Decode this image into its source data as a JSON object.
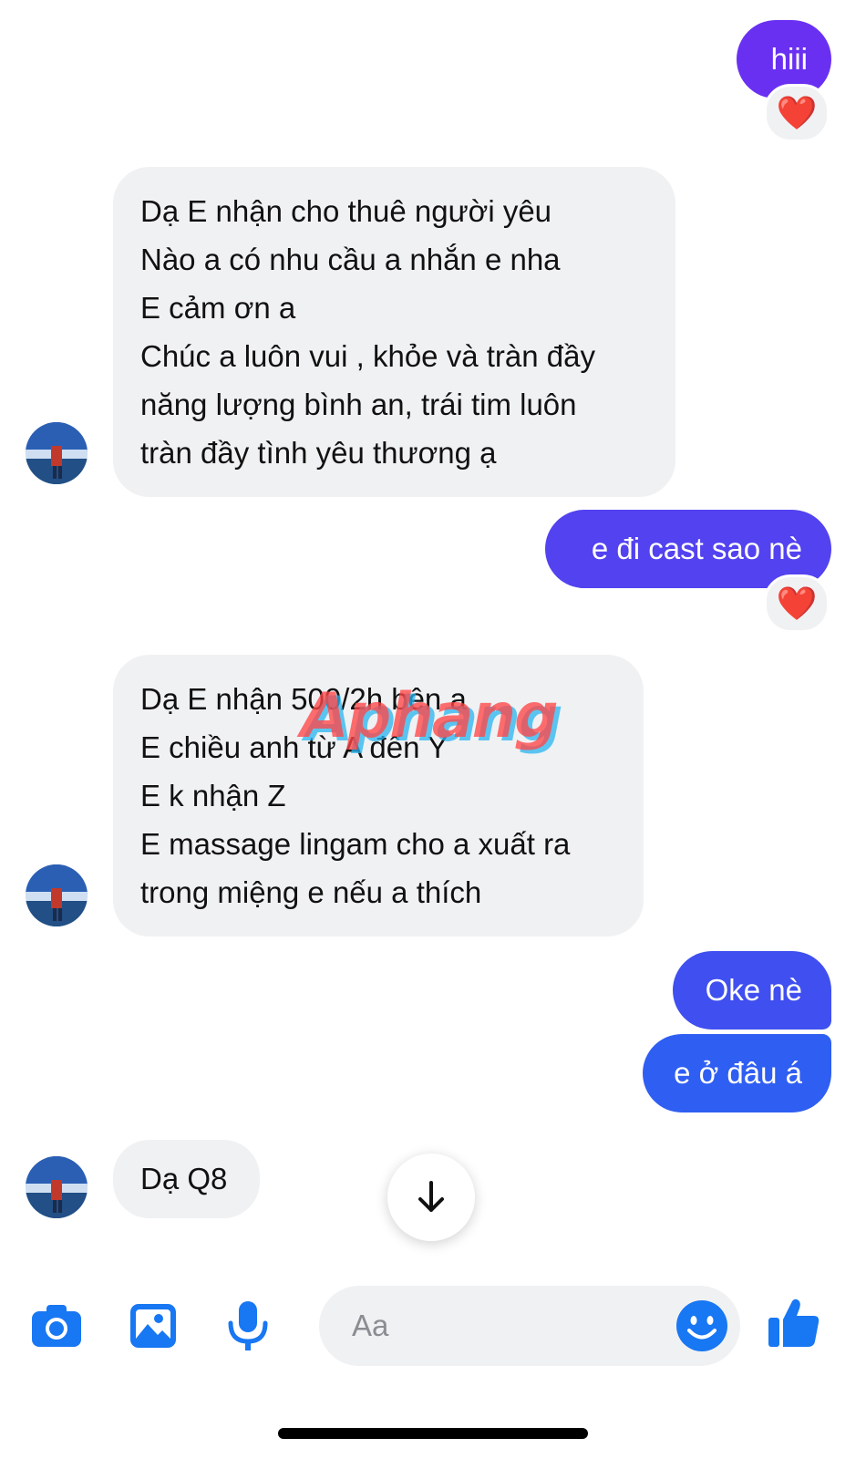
{
  "colors": {
    "accent": "#1877f2",
    "outgoing_purple": "#6a30f2",
    "outgoing_mid": "#5242f0",
    "outgoing_blue": "#3f4ff0",
    "outgoing_blue2": "#2f5ef2",
    "incoming_bg": "#f0f1f3",
    "reaction_heart": "#f0192f"
  },
  "messages": [
    {
      "side": "out",
      "text": "hiii",
      "reaction": "❤️"
    },
    {
      "side": "in",
      "text": "Dạ E nhận cho thuê người yêu\nNào a có nhu cầu a nhắn e nha\nE cảm ơn a\nChúc a luôn vui , khỏe và tràn đầy\nnăng lượng bình an, trái tim luôn\ntràn đầy tình yêu thương ạ"
    },
    {
      "side": "out",
      "text": "e đi cast sao nè",
      "reaction": "❤️"
    },
    {
      "side": "in",
      "text": "Dạ E nhận 500/2h bên a\nE chiều anh từ A đến Y\nE k nhận Z\nE massage lingam cho a xuất ra\ntrong miệng e nếu a thích"
    },
    {
      "side": "out",
      "text": "Oke nè"
    },
    {
      "side": "out",
      "text": "e ở đâu á"
    },
    {
      "side": "in",
      "text": "Dạ Q8"
    }
  ],
  "watermark": "Aphang",
  "composer": {
    "placeholder": "Aa"
  },
  "icons": {
    "camera": "camera-icon",
    "gallery": "image-icon",
    "mic": "microphone-icon",
    "emoji": "smiley-icon",
    "like": "thumbs-up-icon",
    "scroll": "arrow-down-icon"
  }
}
